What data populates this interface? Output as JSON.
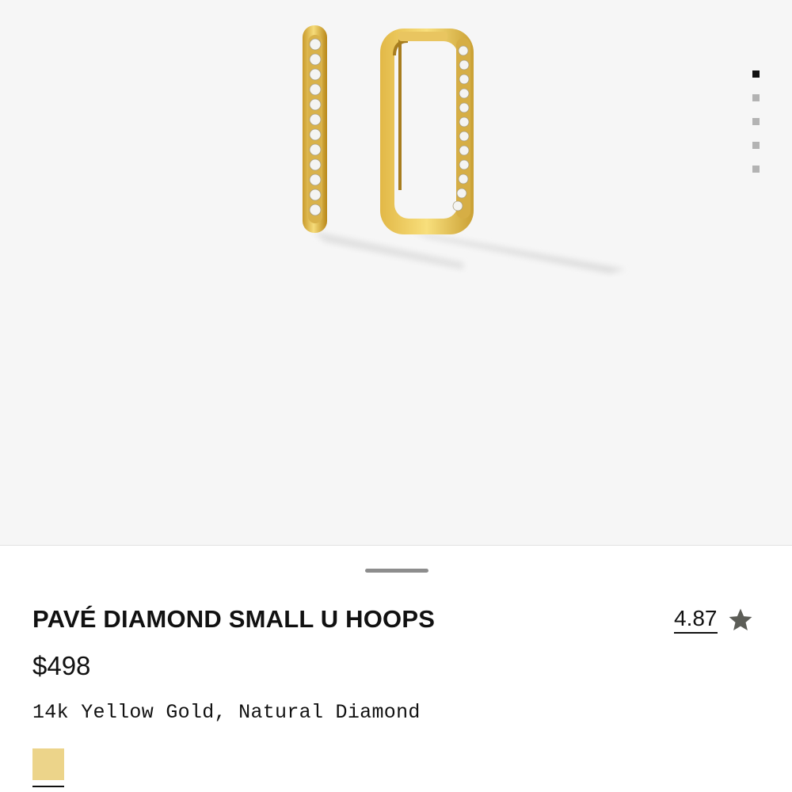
{
  "product": {
    "title": "PAVÉ DIAMOND SMALL U HOOPS",
    "rating": "4.87",
    "price": "$498",
    "materials": "14k Yellow Gold, Natural Diamond"
  },
  "gallery": {
    "image_subject": "pave-diamond-u-hoop-earrings",
    "slide_count": 5,
    "active_slide": 1
  },
  "icons": {
    "rating": "star-icon"
  },
  "colors": {
    "gallery_background": "#f6f6f6",
    "gold": "#e7c75a",
    "swatch": "#ecd48a",
    "star": "#5c5d57",
    "dot_active": "#111111",
    "dot_inactive": "#b3b3b3"
  }
}
